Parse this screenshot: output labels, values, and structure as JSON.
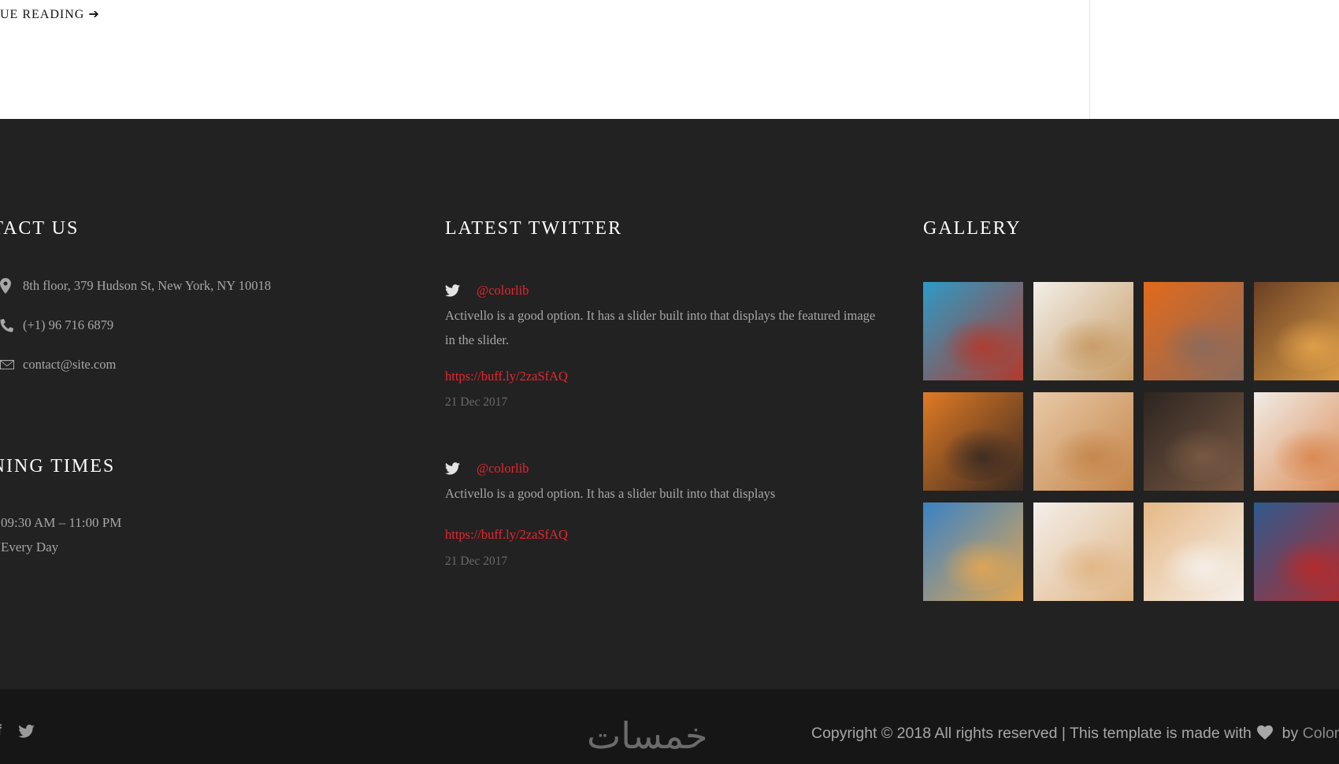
{
  "top": {
    "continue_reading": "UE READING ➔"
  },
  "contact": {
    "title": "NTACT US",
    "address": "8th floor, 379 Hudson St, New York, NY 10018",
    "phone": "(+1) 96 716 6879",
    "email": "contact@site.com",
    "icons": [
      "map-marker-icon",
      "phone-icon",
      "envelope-icon"
    ]
  },
  "opening": {
    "title": "ENING TIMES",
    "hours": "09:30 AM – 11:00 PM",
    "days": "Every Day"
  },
  "twitter": {
    "title": "LATEST TWITTER",
    "tweets": [
      {
        "user": "@colorlib",
        "text": "Activello is a good option. It has a slider built into that displays the featured image in the slider.",
        "link": "https://buff.ly/2zaSfAQ",
        "date": "21 Dec 2017"
      },
      {
        "user": "@colorlib",
        "text": "Activello is a good option. It has a slider built into that displays",
        "link": "https://buff.ly/2zaSfAQ",
        "date": "21 Dec 2017"
      }
    ]
  },
  "gallery": {
    "title": "GALLERY",
    "images": [
      {
        "name": "gallery-image-salad-board",
        "colors": [
          "#2c9bc7",
          "#b23a2b"
        ]
      },
      {
        "name": "gallery-image-pastries",
        "colors": [
          "#f2efe9",
          "#c79a63"
        ]
      },
      {
        "name": "gallery-image-grilled-steak",
        "colors": [
          "#e26a1b",
          "#8a6a5c"
        ]
      },
      {
        "name": "gallery-image-fish-plate",
        "colors": [
          "#6b3f24",
          "#e2a24a"
        ]
      },
      {
        "name": "gallery-image-roast-fire",
        "colors": [
          "#e07a24",
          "#3a2a22"
        ]
      },
      {
        "name": "gallery-image-dinner-drinks",
        "colors": [
          "#e8c9a7",
          "#c4854a"
        ]
      },
      {
        "name": "gallery-image-chef-kitchen",
        "colors": [
          "#2d2520",
          "#7a5a44"
        ]
      },
      {
        "name": "gallery-image-shrimp-dish",
        "colors": [
          "#f1ece6",
          "#d9864e"
        ]
      },
      {
        "name": "gallery-image-city-church",
        "colors": [
          "#3a82c4",
          "#e2a652"
        ]
      },
      {
        "name": "gallery-image-cream-tarts",
        "colors": [
          "#f3efea",
          "#e0b585"
        ]
      },
      {
        "name": "gallery-image-plated-dessert",
        "colors": [
          "#e6b886",
          "#f5f0ea"
        ]
      },
      {
        "name": "gallery-image-christmas-ornament",
        "colors": [
          "#2f5a8e",
          "#b52a2a"
        ]
      }
    ]
  },
  "bottom": {
    "facebook": "f",
    "watermark": "خمسات",
    "copyright": "Copyright © 2018 All rights reserved | This template is made with",
    "by": "by",
    "brand": "Colorlib"
  },
  "colors": {
    "accent": "#e8262c",
    "footer_bg": "#222223",
    "bottom_bg": "#161617",
    "text_muted": "#a7a7a7"
  }
}
